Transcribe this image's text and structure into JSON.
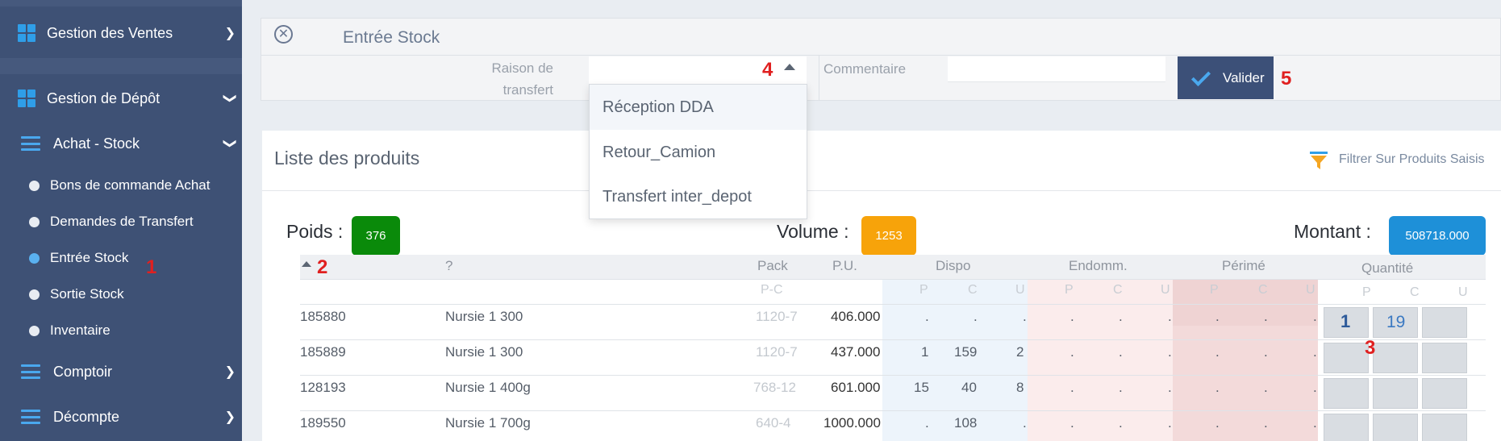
{
  "sidebar": {
    "items": [
      {
        "label": "Gestion des Ventes",
        "icon": "grid-icon"
      },
      {
        "label": "Gestion de Dépôt",
        "icon": "grid-icon"
      },
      {
        "label": "Achat - Stock",
        "icon": "bars-icon"
      },
      {
        "label": "Bons de commande Achat"
      },
      {
        "label": "Demandes de Transfert"
      },
      {
        "label": "Entrée Stock",
        "active": true
      },
      {
        "label": "Sortie Stock"
      },
      {
        "label": "Inventaire"
      },
      {
        "label": "Comptoir",
        "icon": "bars-icon"
      },
      {
        "label": "Décompte",
        "icon": "bars-icon"
      }
    ]
  },
  "markers": [
    "1",
    "2",
    "3",
    "4",
    "5"
  ],
  "header": {
    "title": "Entrée Stock"
  },
  "form": {
    "raison_label_line1": "Raison de",
    "raison_label_line2": "transfert",
    "comment_label": "Commentaire",
    "comment_value": "",
    "valider_label": "Valider"
  },
  "dropdown": {
    "options": [
      "Réception DDA",
      "Retour_Camion",
      "Transfert inter_depot"
    ]
  },
  "list": {
    "title": "Liste des produits",
    "filter_label": "Filtrer Sur Produits Saisis"
  },
  "kpis": {
    "poids_label": "Poids :",
    "poids_value": "376",
    "volume_label": "Volume :",
    "volume_value": "1253",
    "montant_label": "Montant :",
    "montant_value": "508718.000"
  },
  "table": {
    "headers": {
      "col2": "?",
      "pack": "Pack",
      "pu": "P.U.",
      "dispo": "Dispo",
      "endomm": "Endomm.",
      "perime": "Périmé",
      "quantite": "Quantité"
    },
    "sub": {
      "pc": "P-C",
      "p": "P",
      "c": "C",
      "u": "U"
    },
    "rows": [
      {
        "code": "185880",
        "name": "Nursie 1 300",
        "pack": "1120-7",
        "pu": "406.000",
        "dp": ".",
        "dc": ".",
        "du": ".",
        "ep": ".",
        "ec": ".",
        "eu": ".",
        "pp": ".",
        "pc2": ".",
        "pu2": ".",
        "qp": "1",
        "qc": "19"
      },
      {
        "code": "185889",
        "name": "Nursie 1 300",
        "pack": "1120-7",
        "pu": "437.000",
        "dp": "1",
        "dc": "159",
        "du": "2",
        "ep": ".",
        "ec": ".",
        "eu": ".",
        "pp": ".",
        "pc2": ".",
        "pu2": ".",
        "qp": "",
        "qc": ""
      },
      {
        "code": "128193",
        "name": "Nursie 1 400g",
        "pack": "768-12",
        "pu": "601.000",
        "dp": "15",
        "dc": "40",
        "du": "8",
        "ep": ".",
        "ec": ".",
        "eu": ".",
        "pp": ".",
        "pc2": ".",
        "pu2": ".",
        "qp": "",
        "qc": ""
      },
      {
        "code": "189550",
        "name": "Nursie 1 700g",
        "pack": "640-4",
        "pu": "1000.000",
        "dp": ".",
        "dc": "108",
        "du": ".",
        "ep": ".",
        "ec": ".",
        "eu": ".",
        "pp": ".",
        "pc2": ".",
        "pu2": ".",
        "qp": "",
        "qc": ""
      }
    ]
  },
  "colors": {
    "sidebar_bg": "#3e5175",
    "accent": "#2f9ee8",
    "poids_badge": "#0a8a0a",
    "volume_badge": "#f7a30a",
    "montant_badge": "#1e90d8",
    "dispo_bg": "#edf4fb",
    "endomm_bg": "#fbecec",
    "perime_bg": "#f3dada",
    "marker": "#e02020"
  }
}
